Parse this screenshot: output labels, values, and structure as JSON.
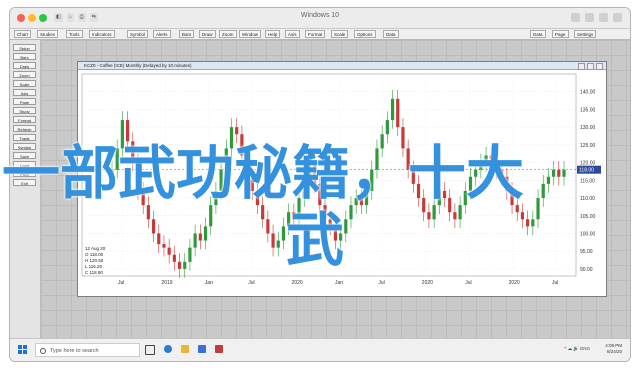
{
  "window": {
    "title": "Windows 10",
    "toolbar_left_icons": [
      "◧",
      "⌂",
      "⎙",
      "⇆"
    ]
  },
  "toolbar": {
    "items": [
      "Chart",
      "Studies",
      "Tools",
      "Indicators",
      "Symbol",
      "Alerts",
      "Bars",
      "Draw",
      "Zoom",
      "Window",
      "Help",
      "Axis",
      "Format",
      "Scale",
      "Options",
      "Data"
    ],
    "right_items": [
      "Data",
      "Page",
      "Settings"
    ]
  },
  "left_panel": {
    "buttons": [
      "Setup",
      "Bars",
      "Draw",
      "Zoom",
      "Scale",
      "Axis",
      "Page",
      "Study",
      "Format",
      "Refresh",
      "Trade",
      "Symbol",
      "Save",
      "Load",
      "Print",
      "Exit"
    ]
  },
  "chart_window": {
    "title": "KCZ0 - Coffee (ICE) Monthly (Delayed by 10 minutes)",
    "y_ticks": [
      "140.00",
      "135.00",
      "130.00",
      "125.00",
      "120.00",
      "115.00",
      "110.00",
      "105.00",
      "100.00",
      "95.00",
      "90.00"
    ],
    "last_price": "118.00",
    "x_labels": [
      "Jul",
      "2019",
      "Jan",
      "Jul",
      "2020",
      "Jan",
      "Jul",
      "2020",
      "Jul",
      "2020",
      "Jul"
    ],
    "data_box": [
      "12 Aug 20",
      "O 118.00",
      "H 120.50",
      "L 116.20",
      "C 118.90"
    ]
  },
  "chart_data": {
    "type": "candlestick",
    "title": "KCZ0 - Coffee (ICE) Monthly (Delayed by 10 minutes)",
    "ylim": [
      88,
      145
    ],
    "last_value": 118.0,
    "closes": [
      118,
      124,
      132,
      126,
      120,
      112,
      108,
      104,
      100,
      97,
      96,
      94,
      92,
      90,
      92,
      96,
      100,
      98,
      102,
      108,
      112,
      118,
      124,
      130,
      128,
      122,
      116,
      112,
      108,
      104,
      100,
      96,
      98,
      102,
      106,
      104,
      110,
      116,
      120,
      114,
      108,
      104,
      102,
      98,
      100,
      104,
      108,
      110,
      108,
      112,
      118,
      124,
      128,
      132,
      138,
      130,
      124,
      118,
      114,
      110,
      106,
      104,
      108,
      112,
      110,
      106,
      104,
      108,
      112,
      116,
      118,
      120,
      122,
      120,
      118,
      116,
      112,
      108,
      106,
      104,
      102,
      104,
      110,
      114,
      116,
      118,
      116,
      118
    ]
  },
  "overlay": {
    "line1": "一部武功秘籍，十大",
    "line2": "武"
  },
  "taskbar": {
    "search_placeholder": "Type here to search",
    "time": "4:09 PM",
    "date": "8/24/20",
    "tray": "^ ☁ 🔊 ENG"
  },
  "colors": {
    "up": "#2e9a3c",
    "down": "#c83a3a",
    "overlay": "#3391de",
    "price_tag": "#2b4a9c"
  }
}
